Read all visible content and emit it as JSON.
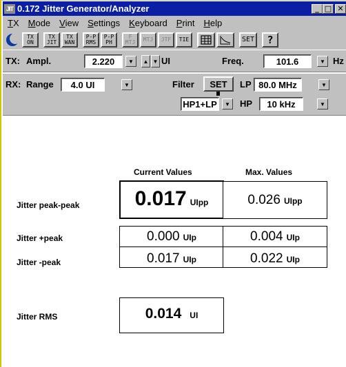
{
  "window": {
    "title": "0.172 Jitter Generator/Analyzer",
    "logo": "JIT"
  },
  "menu": [
    {
      "pre": "",
      "u": "T",
      "post": "X"
    },
    {
      "pre": "",
      "u": "M",
      "post": "ode"
    },
    {
      "pre": "",
      "u": "V",
      "post": "iew"
    },
    {
      "pre": "",
      "u": "S",
      "post": "ettings"
    },
    {
      "pre": "",
      "u": "K",
      "post": "eyboard"
    },
    {
      "pre": "",
      "u": "P",
      "post": "rint"
    },
    {
      "pre": "",
      "u": "H",
      "post": "elp"
    }
  ],
  "toolbar": {
    "tx_on": [
      "TX",
      "ON"
    ],
    "tx_jit": [
      "TX",
      "JIT"
    ],
    "tx_wan": [
      "TX",
      "WAN"
    ],
    "pp_rms": [
      "P-P",
      "RMS"
    ],
    "pp_ph": [
      "P-P",
      "PH"
    ],
    "f_mtj": [
      "F",
      "MTJ"
    ],
    "mtj": "MTJ",
    "jtf": "JTF",
    "tie": "TIE",
    "set": "SET",
    "help": "?"
  },
  "tx": {
    "label": "TX:",
    "ampl_label": "Ampl.",
    "ampl_value": "2.220",
    "ampl_unit": "UI",
    "freq_label": "Freq.",
    "freq_value": "101.6",
    "freq_unit": "Hz"
  },
  "rx": {
    "label": "RX:",
    "range_label": "Range",
    "range_value": "4.0 UI",
    "filter_label": "Filter",
    "filter_set": "SET",
    "filter_value": "HP1+LP",
    "lp_label": "LP",
    "lp_value": "80.0 MHz",
    "hp_label": "HP",
    "hp_value": "10 kHz"
  },
  "results": {
    "header_current": "Current Values",
    "header_max": "Max. Values",
    "pp_label": "Jitter  peak-peak",
    "pp_current": "0.017",
    "pp_current_unit": "UIpp",
    "pp_max": "0.026",
    "pp_max_unit": "UIpp",
    "plus_label": "Jitter  +peak",
    "plus_current": "0.000",
    "plus_current_unit": "UIp",
    "plus_max": "0.004",
    "plus_max_unit": "UIp",
    "minus_label": "Jitter  -peak",
    "minus_current": "0.017",
    "minus_current_unit": "UIp",
    "minus_max": "0.022",
    "minus_max_unit": "UIp",
    "rms_label": "Jitter RMS",
    "rms_value": "0.014",
    "rms_unit": "UI"
  },
  "colors": {
    "titlebar": "#0a1fa3",
    "face": "#c0c0c0",
    "accent_border": "#d4c400"
  }
}
